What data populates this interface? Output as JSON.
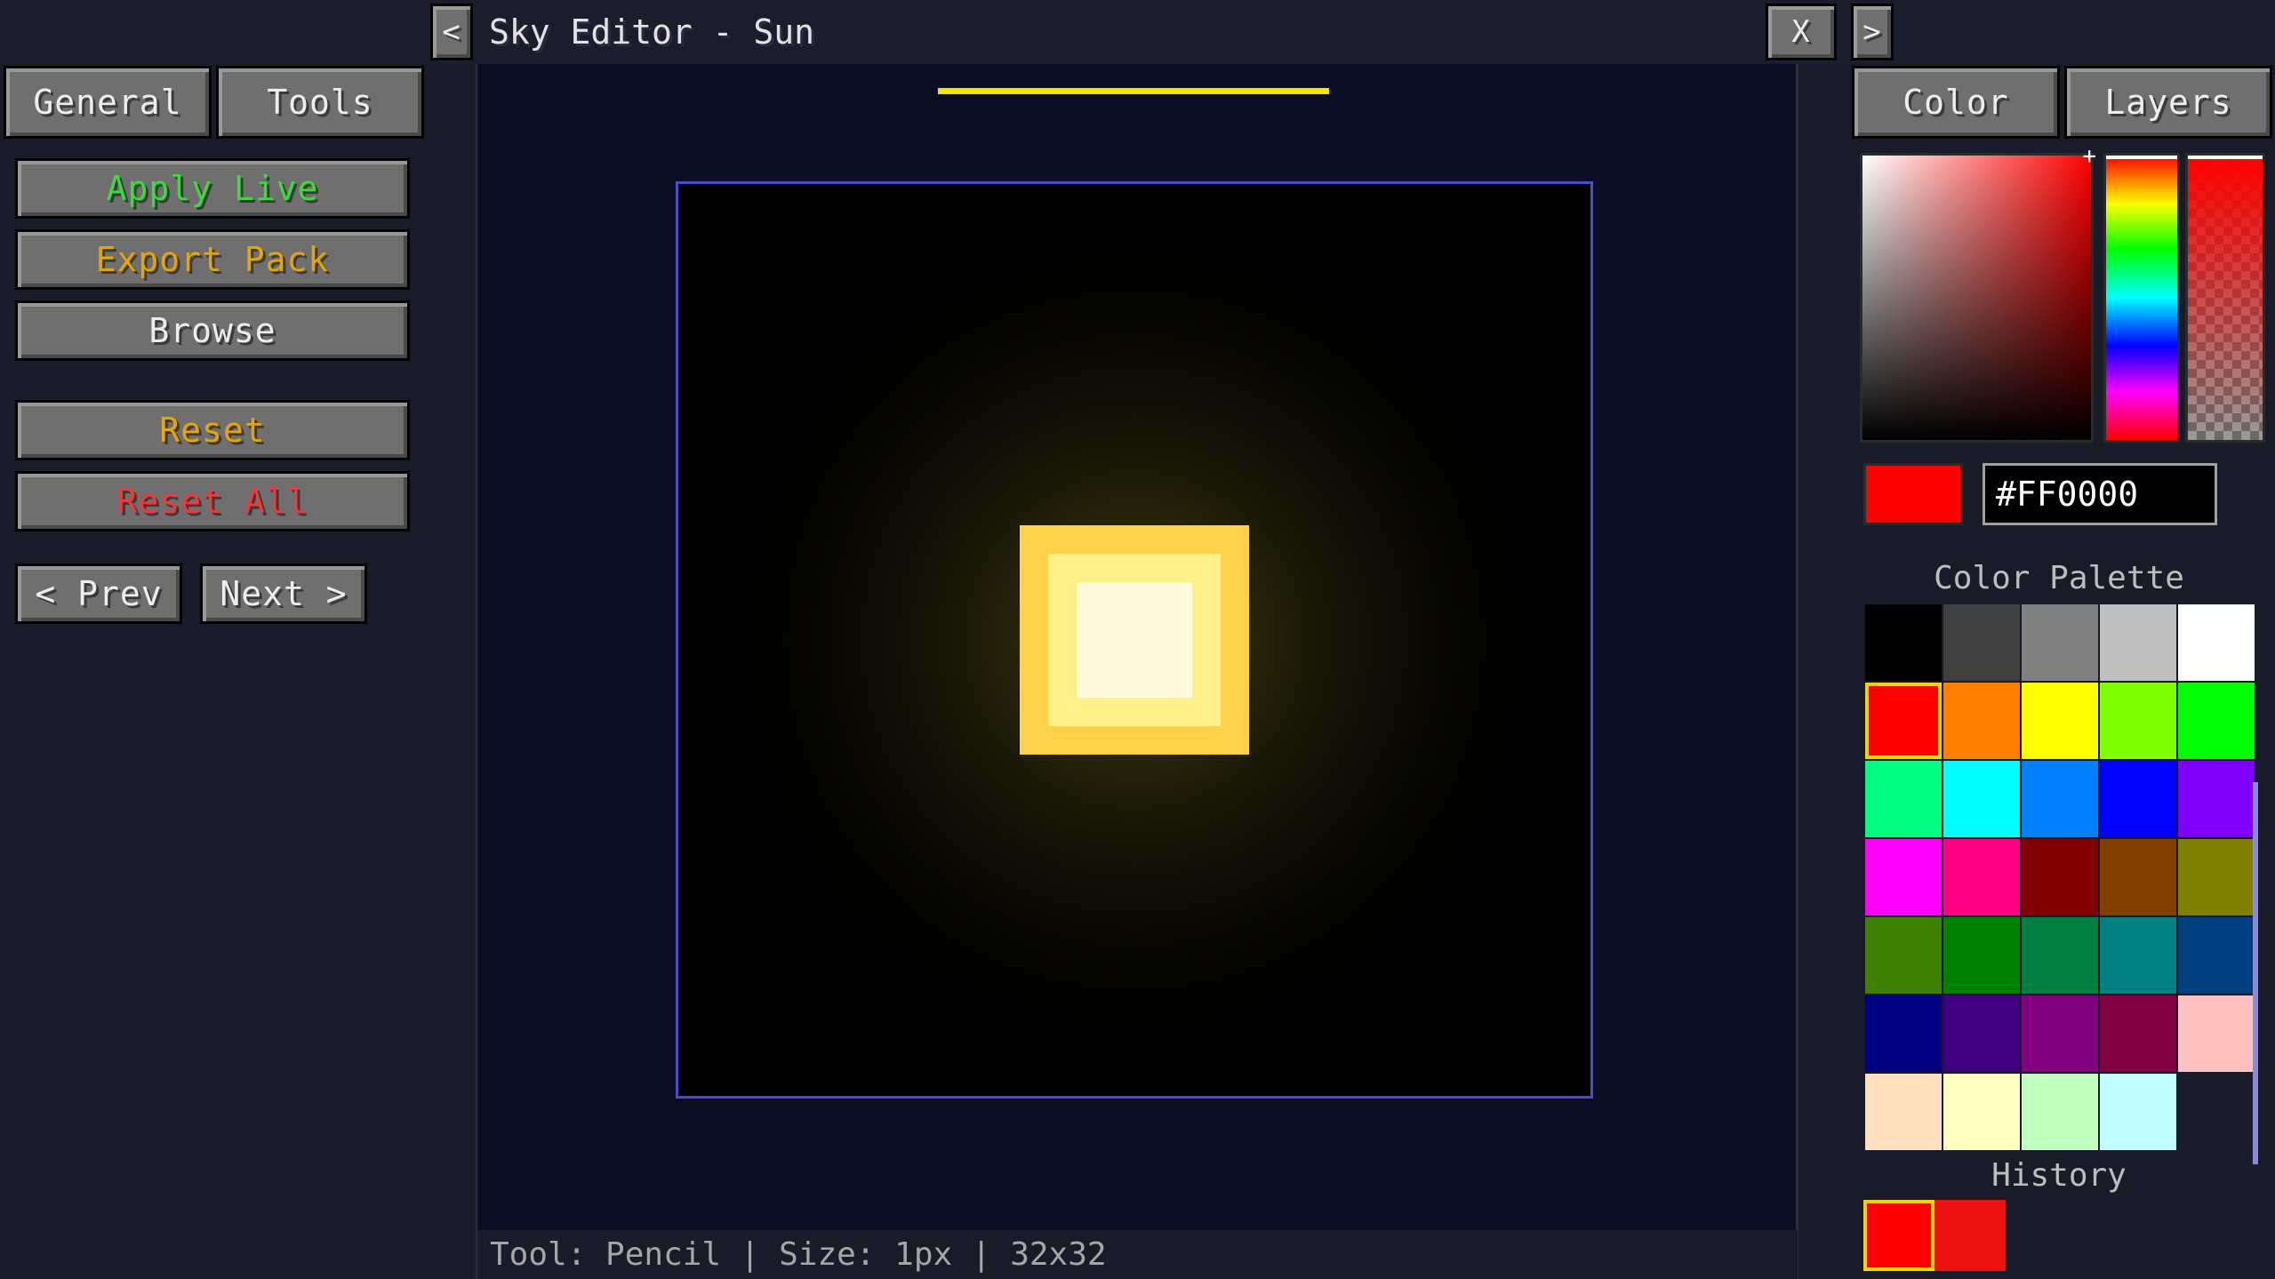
{
  "window": {
    "title": "Sky Editor - Sun"
  },
  "nav": {
    "prev_icon": "<",
    "next_icon": ">",
    "close_icon": "X"
  },
  "left_tabs": [
    "General",
    "Tools"
  ],
  "left_actions": {
    "apply_live": {
      "label": "Apply Live",
      "color": "#3bdc3b"
    },
    "export_pack": {
      "label": "Export Pack",
      "color": "#e6a500"
    },
    "browse": {
      "label": "Browse",
      "color": "#ededed"
    },
    "reset": {
      "label": "Reset",
      "color": "#e6a500"
    },
    "reset_all": {
      "label": "Reset All",
      "color": "#f03a3a"
    },
    "prev": "< Prev",
    "next": "Next >"
  },
  "right_tabs": [
    "Color",
    "Layers"
  ],
  "color_picker": {
    "hex_value": "#FF0000",
    "current_color": "#FF0000",
    "palette_label": "Color Palette",
    "history_label": "History",
    "palette": [
      "#000000",
      "#404040",
      "#808080",
      "#c0c0c0",
      "#ffffff",
      "#ff0000",
      "#ff8000",
      "#ffff00",
      "#80ff00",
      "#00ff00",
      "#00ff80",
      "#00ffff",
      "#0080ff",
      "#0000ff",
      "#8000ff",
      "#ff00ff",
      "#ff0080",
      "#800000",
      "#804000",
      "#808000",
      "#408000",
      "#008000",
      "#008040",
      "#008080",
      "#004080",
      "#000080",
      "#400080",
      "#800080",
      "#800040",
      "#ffc0c0",
      "#ffe0c0",
      "#ffffc0",
      "#c0ffc0",
      "#c0ffff"
    ],
    "selected_index": 5,
    "history": [
      "#ff0000",
      "#ee1111"
    ]
  },
  "canvas": {
    "sun_colors": {
      "outer": "#ffd24a",
      "middle": "#fff18a",
      "inner": "#fffadc"
    }
  },
  "status": "Tool: Pencil | Size: 1px | 32x32"
}
